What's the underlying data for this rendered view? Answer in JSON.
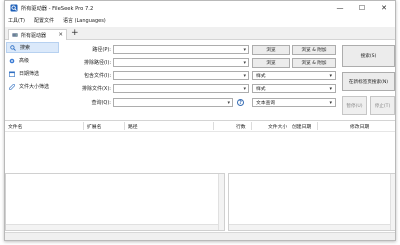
{
  "window": {
    "title": "所有驱动器 - FileSeek Pro 7.2",
    "controls": {
      "minimize": "—",
      "maximize": "☐",
      "close": "✕"
    }
  },
  "menu": [
    "工具(T)",
    "配置文件",
    "语言 (Languages)"
  ],
  "tabs": {
    "active_label": "所有驱动器",
    "close_glyph": "✕",
    "add_glyph": "+"
  },
  "sidebar": {
    "items": [
      {
        "label": "搜索",
        "icon": "search-icon"
      },
      {
        "label": "高级",
        "icon": "advanced-icon"
      },
      {
        "label": "日期筛选",
        "icon": "calendar-icon"
      },
      {
        "label": "文件大小筛选",
        "icon": "ruler-icon"
      }
    ]
  },
  "form": {
    "path_label": "路径(P):",
    "exclude_path_label": "排除路径(I):",
    "include_files_label": "包含文件(I):",
    "exclude_files_label": "排除文件(X):",
    "query_label": "查询(Q):",
    "browse_label": "浏览",
    "browse_add_label": "浏览 & 附加",
    "mode_value": "样式",
    "query_mode_value": "文本查询",
    "arrow_glyph": "▾",
    "help_glyph": "?"
  },
  "actions": {
    "search": "搜索(S)",
    "search_new_tab": "在新标签页搜索(N)",
    "pause": "暂停(U)",
    "stop": "停止(T)"
  },
  "results": {
    "columns": [
      "文件名",
      "扩展名",
      "路径",
      "行数",
      "文件大小",
      "创建日期",
      "修改日期"
    ]
  },
  "colors": {
    "accent": "#dbe9fa",
    "accent_border": "#b7d1f0",
    "icon_blue": "#2e6ec2"
  }
}
